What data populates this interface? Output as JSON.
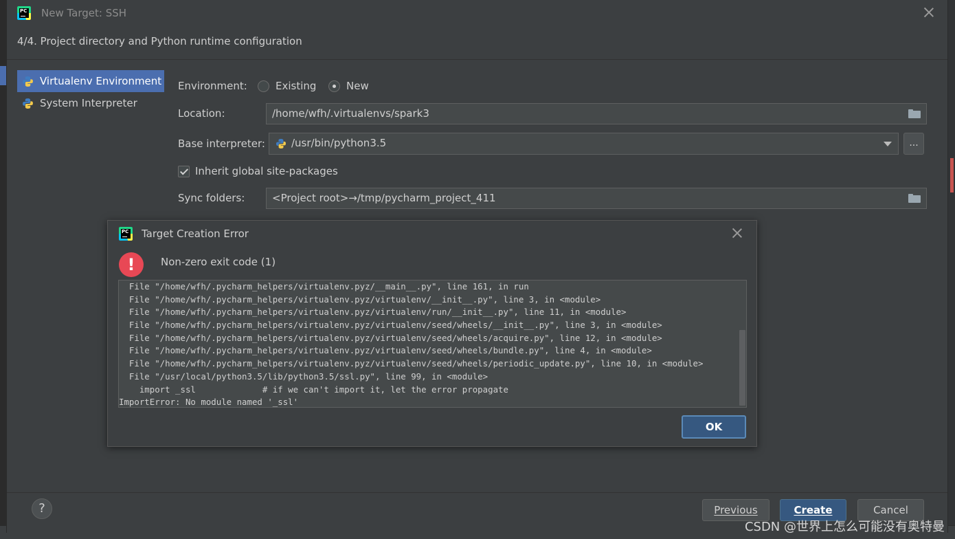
{
  "window": {
    "title": "New Target: SSH",
    "step_header": "4/4. Project directory and Python runtime configuration"
  },
  "env_list": [
    {
      "label": "Virtualenv Environment",
      "selected": true
    },
    {
      "label": "System Interpreter",
      "selected": false
    }
  ],
  "form": {
    "environment_label": "Environment:",
    "environment_options": [
      "Existing",
      "New"
    ],
    "environment_selected": "New",
    "location_label": "Location:",
    "location_value": "/home/wfh/.virtualenvs/spark3",
    "base_interpreter_label": "Base interpreter:",
    "base_interpreter_value": "/usr/bin/python3.5",
    "ellipsis_label": "...",
    "inherit_label": "Inherit global site-packages",
    "inherit_checked": true,
    "sync_label": "Sync folders:",
    "sync_value": "<Project root>→/tmp/pycharm_project_411"
  },
  "footer": {
    "help_label": "?",
    "previous_label": "Previous",
    "create_label": "Create",
    "cancel_label": "Cancel"
  },
  "error_dialog": {
    "title": "Target Creation Error",
    "badge": "!",
    "message": "Non-zero exit code (1)",
    "trace_lines": [
      "  File \"/home/wfh/.pycharm_helpers/virtualenv.pyz/__main__.py\", line 161, in run",
      "  File \"/home/wfh/.pycharm_helpers/virtualenv.pyz/virtualenv/__init__.py\", line 3, in <module>",
      "  File \"/home/wfh/.pycharm_helpers/virtualenv.pyz/virtualenv/run/__init__.py\", line 11, in <module>",
      "  File \"/home/wfh/.pycharm_helpers/virtualenv.pyz/virtualenv/seed/wheels/__init__.py\", line 3, in <module>",
      "  File \"/home/wfh/.pycharm_helpers/virtualenv.pyz/virtualenv/seed/wheels/acquire.py\", line 12, in <module>",
      "  File \"/home/wfh/.pycharm_helpers/virtualenv.pyz/virtualenv/seed/wheels/bundle.py\", line 4, in <module>",
      "  File \"/home/wfh/.pycharm_helpers/virtualenv.pyz/virtualenv/seed/wheels/periodic_update.py\", line 10, in <module>",
      "  File \"/usr/local/python3.5/lib/python3.5/ssl.py\", line 99, in <module>",
      "    import _ssl             # if we can't import it, let the error propagate",
      "ImportError: No module named '_ssl'"
    ],
    "ok_label": "OK"
  },
  "watermark": "CSDN @世界上怎么可能没有奥特曼"
}
